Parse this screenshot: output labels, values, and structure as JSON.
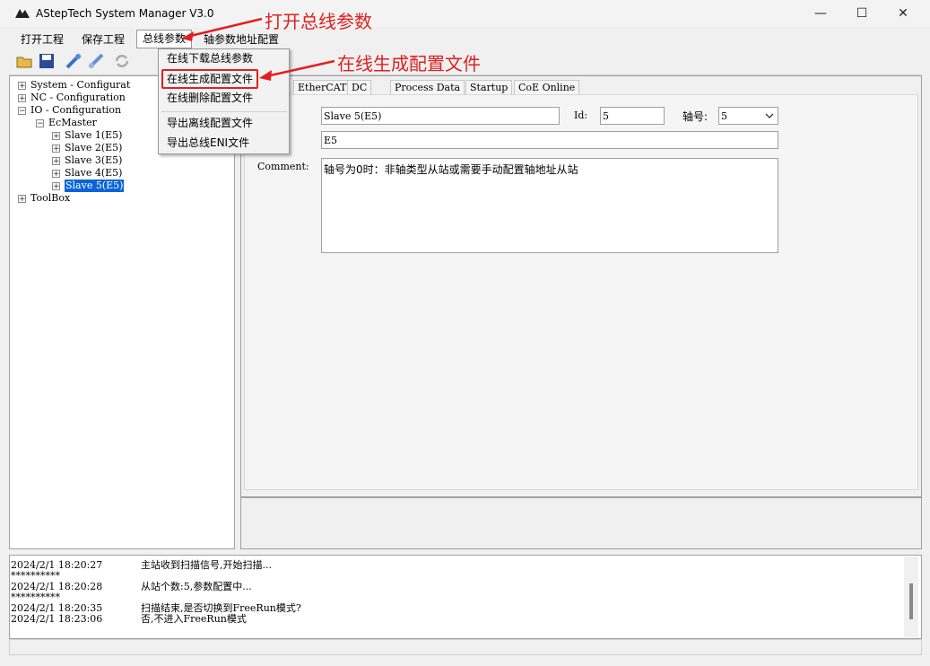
{
  "window": {
    "title": "AStepTech System Manager V3.0",
    "buttons": {
      "minimize": "—",
      "maximize": "☐",
      "close": "✕"
    }
  },
  "menubar": {
    "items": [
      "打开工程",
      "保存工程",
      "总线参数",
      "轴参数地址配置"
    ]
  },
  "bus_menu": {
    "items": [
      "在线下载总线参数",
      "在线生成配置文件",
      "在线删除配置文件",
      "导出离线配置文件",
      "导出总线ENI文件"
    ]
  },
  "annotations": {
    "arrow1": "打开总线参数",
    "arrow2": "在线生成配置文件",
    "color": "#e02020"
  },
  "tree": {
    "nodes": [
      {
        "label": "System - Configurat",
        "expander": "+"
      },
      {
        "label": "NC - Configuration",
        "expander": "+"
      },
      {
        "label": "IO - Configuration",
        "expander": "−"
      },
      {
        "label": "EcMaster",
        "expander": "−"
      },
      {
        "label": "Slave 1(E5)",
        "expander": "+"
      },
      {
        "label": "Slave 2(E5)",
        "expander": "+"
      },
      {
        "label": "Slave 3(E5)",
        "expander": "+"
      },
      {
        "label": "Slave 4(E5)",
        "expander": "+"
      },
      {
        "label": "Slave 5(E5)",
        "expander": "+",
        "selected": true
      },
      {
        "label": "ToolBox",
        "expander": "+"
      }
    ]
  },
  "tabs": [
    "EtherCAT",
    "DC",
    "Process Data",
    "Startup",
    "CoE Online"
  ],
  "slave_form": {
    "name_value": "Slave 5(E5)",
    "id_label": "Id:",
    "id_value": "5",
    "axis_label": "轴号:",
    "axis_value": "5",
    "type_value": "E5",
    "comment_label": "Comment:",
    "comment_value": "轴号为0时：非轴类型从站或需要手动配置轴地址从站"
  },
  "log": {
    "lines": [
      {
        "time": "2024/2/1 18:20:27",
        "msg": "主站收到扫描信号,开始扫描..."
      },
      {
        "time": "**********",
        "msg": ""
      },
      {
        "time": "2024/2/1 18:20:28",
        "msg": "从站个数:5,参数配置中..."
      },
      {
        "time": "**********",
        "msg": ""
      },
      {
        "time": "2024/2/1 18:20:35",
        "msg": "扫描结束,是否切换到FreeRun模式?"
      },
      {
        "time": "2024/2/1 18:23:06",
        "msg": "否,不进入FreeRun模式"
      }
    ]
  },
  "colors": {
    "selection": "#0a64d8",
    "annotation": "#e02020"
  }
}
